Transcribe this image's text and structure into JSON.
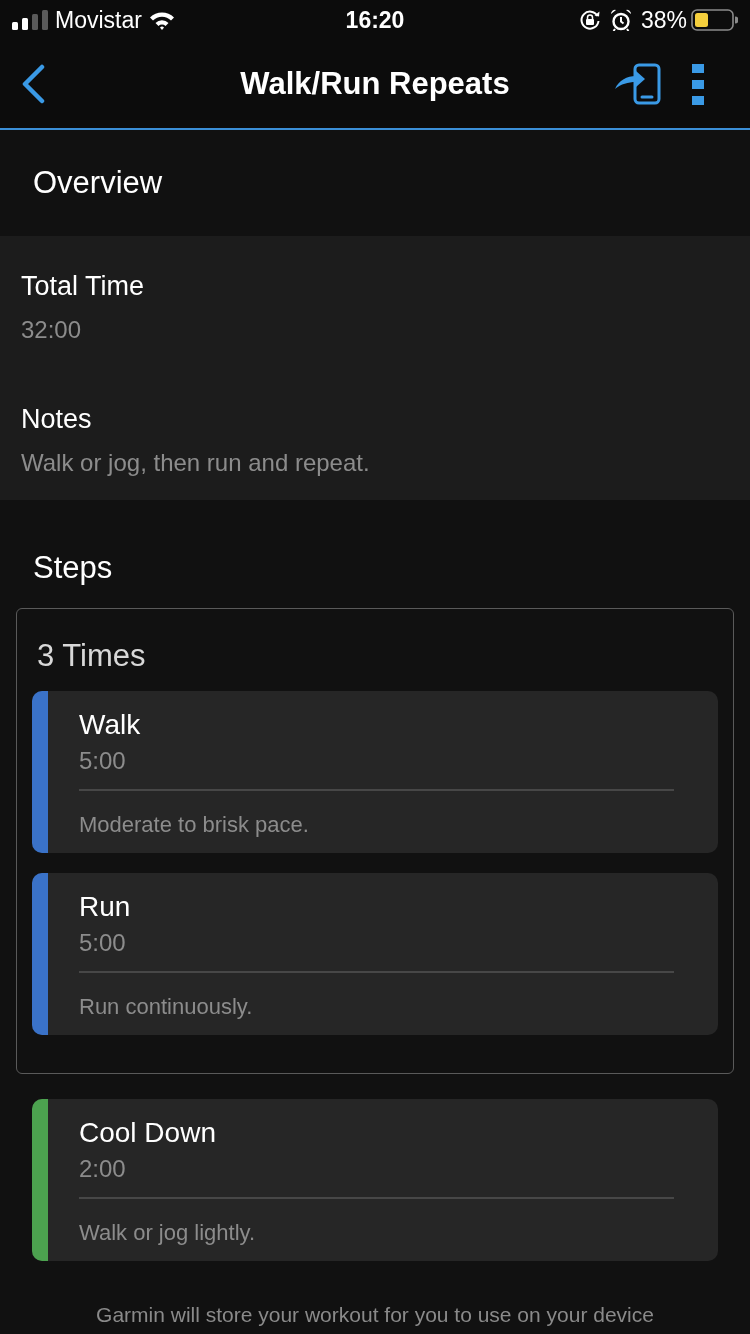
{
  "status_bar": {
    "carrier": "Movistar",
    "time": "16:20",
    "battery_text": "38%"
  },
  "nav_bar": {
    "title": "Walk/Run Repeats"
  },
  "overview": {
    "heading": "Overview",
    "fields": [
      {
        "label": "Total Time",
        "value": "32:00"
      },
      {
        "label": "Notes",
        "value": "Walk or jog, then run and repeat."
      }
    ]
  },
  "steps": {
    "heading": "Steps",
    "items": [
      {
        "kind": "repeat",
        "title": "3 Times",
        "steps": [
          {
            "name": "Walk",
            "duration": "5:00",
            "note": "Moderate to brisk pace.",
            "color": "#3a72c8"
          },
          {
            "name": "Run",
            "duration": "5:00",
            "note": "Run continuously.",
            "color": "#3a72c8"
          }
        ]
      },
      {
        "kind": "step",
        "name": "Cool Down",
        "duration": "2:00",
        "note": "Walk or jog lightly.",
        "color": "#4ca24f"
      }
    ]
  },
  "footer": {
    "text": "Garmin will store your workout for you to use on your device"
  }
}
